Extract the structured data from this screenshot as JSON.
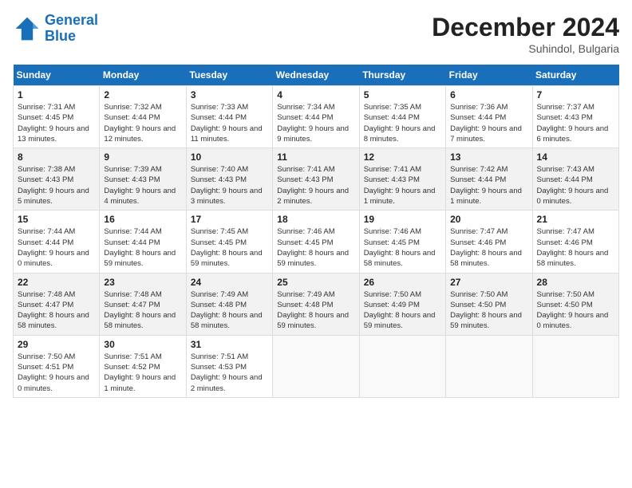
{
  "header": {
    "logo_line1": "General",
    "logo_line2": "Blue",
    "month": "December 2024",
    "location": "Suhindol, Bulgaria"
  },
  "weekdays": [
    "Sunday",
    "Monday",
    "Tuesday",
    "Wednesday",
    "Thursday",
    "Friday",
    "Saturday"
  ],
  "weeks": [
    [
      {
        "day": "1",
        "info": "Sunrise: 7:31 AM\nSunset: 4:45 PM\nDaylight: 9 hours and 13 minutes."
      },
      {
        "day": "2",
        "info": "Sunrise: 7:32 AM\nSunset: 4:44 PM\nDaylight: 9 hours and 12 minutes."
      },
      {
        "day": "3",
        "info": "Sunrise: 7:33 AM\nSunset: 4:44 PM\nDaylight: 9 hours and 11 minutes."
      },
      {
        "day": "4",
        "info": "Sunrise: 7:34 AM\nSunset: 4:44 PM\nDaylight: 9 hours and 9 minutes."
      },
      {
        "day": "5",
        "info": "Sunrise: 7:35 AM\nSunset: 4:44 PM\nDaylight: 9 hours and 8 minutes."
      },
      {
        "day": "6",
        "info": "Sunrise: 7:36 AM\nSunset: 4:44 PM\nDaylight: 9 hours and 7 minutes."
      },
      {
        "day": "7",
        "info": "Sunrise: 7:37 AM\nSunset: 4:43 PM\nDaylight: 9 hours and 6 minutes."
      }
    ],
    [
      {
        "day": "8",
        "info": "Sunrise: 7:38 AM\nSunset: 4:43 PM\nDaylight: 9 hours and 5 minutes."
      },
      {
        "day": "9",
        "info": "Sunrise: 7:39 AM\nSunset: 4:43 PM\nDaylight: 9 hours and 4 minutes."
      },
      {
        "day": "10",
        "info": "Sunrise: 7:40 AM\nSunset: 4:43 PM\nDaylight: 9 hours and 3 minutes."
      },
      {
        "day": "11",
        "info": "Sunrise: 7:41 AM\nSunset: 4:43 PM\nDaylight: 9 hours and 2 minutes."
      },
      {
        "day": "12",
        "info": "Sunrise: 7:41 AM\nSunset: 4:43 PM\nDaylight: 9 hours and 1 minute."
      },
      {
        "day": "13",
        "info": "Sunrise: 7:42 AM\nSunset: 4:44 PM\nDaylight: 9 hours and 1 minute."
      },
      {
        "day": "14",
        "info": "Sunrise: 7:43 AM\nSunset: 4:44 PM\nDaylight: 9 hours and 0 minutes."
      }
    ],
    [
      {
        "day": "15",
        "info": "Sunrise: 7:44 AM\nSunset: 4:44 PM\nDaylight: 9 hours and 0 minutes."
      },
      {
        "day": "16",
        "info": "Sunrise: 7:44 AM\nSunset: 4:44 PM\nDaylight: 8 hours and 59 minutes."
      },
      {
        "day": "17",
        "info": "Sunrise: 7:45 AM\nSunset: 4:45 PM\nDaylight: 8 hours and 59 minutes."
      },
      {
        "day": "18",
        "info": "Sunrise: 7:46 AM\nSunset: 4:45 PM\nDaylight: 8 hours and 59 minutes."
      },
      {
        "day": "19",
        "info": "Sunrise: 7:46 AM\nSunset: 4:45 PM\nDaylight: 8 hours and 58 minutes."
      },
      {
        "day": "20",
        "info": "Sunrise: 7:47 AM\nSunset: 4:46 PM\nDaylight: 8 hours and 58 minutes."
      },
      {
        "day": "21",
        "info": "Sunrise: 7:47 AM\nSunset: 4:46 PM\nDaylight: 8 hours and 58 minutes."
      }
    ],
    [
      {
        "day": "22",
        "info": "Sunrise: 7:48 AM\nSunset: 4:47 PM\nDaylight: 8 hours and 58 minutes."
      },
      {
        "day": "23",
        "info": "Sunrise: 7:48 AM\nSunset: 4:47 PM\nDaylight: 8 hours and 58 minutes."
      },
      {
        "day": "24",
        "info": "Sunrise: 7:49 AM\nSunset: 4:48 PM\nDaylight: 8 hours and 58 minutes."
      },
      {
        "day": "25",
        "info": "Sunrise: 7:49 AM\nSunset: 4:48 PM\nDaylight: 8 hours and 59 minutes."
      },
      {
        "day": "26",
        "info": "Sunrise: 7:50 AM\nSunset: 4:49 PM\nDaylight: 8 hours and 59 minutes."
      },
      {
        "day": "27",
        "info": "Sunrise: 7:50 AM\nSunset: 4:50 PM\nDaylight: 8 hours and 59 minutes."
      },
      {
        "day": "28",
        "info": "Sunrise: 7:50 AM\nSunset: 4:50 PM\nDaylight: 9 hours and 0 minutes."
      }
    ],
    [
      {
        "day": "29",
        "info": "Sunrise: 7:50 AM\nSunset: 4:51 PM\nDaylight: 9 hours and 0 minutes."
      },
      {
        "day": "30",
        "info": "Sunrise: 7:51 AM\nSunset: 4:52 PM\nDaylight: 9 hours and 1 minute."
      },
      {
        "day": "31",
        "info": "Sunrise: 7:51 AM\nSunset: 4:53 PM\nDaylight: 9 hours and 2 minutes."
      },
      null,
      null,
      null,
      null
    ]
  ]
}
